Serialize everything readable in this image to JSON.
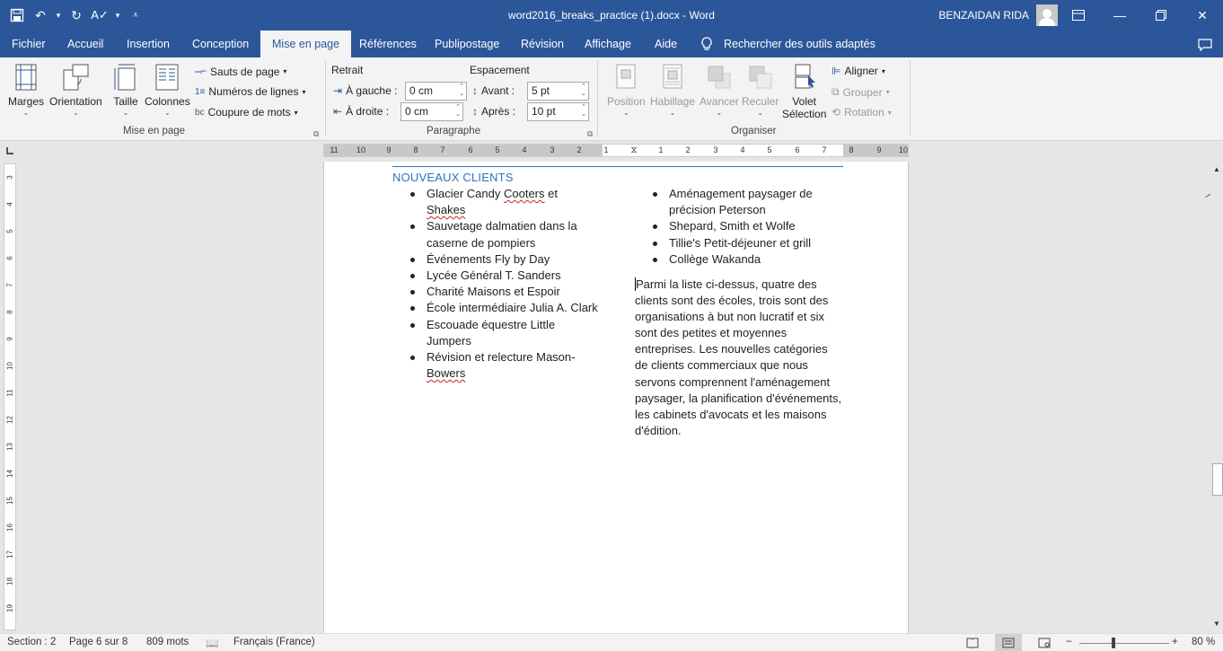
{
  "titlebar": {
    "doc_title": "word2016_breaks_practice (1).docx  -  Word",
    "user_name": "BENZAIDAN RIDA"
  },
  "tabs": [
    "Fichier",
    "Accueil",
    "Insertion",
    "Conception",
    "Mise en page",
    "Références",
    "Publipostage",
    "Révision",
    "Affichage",
    "Aide"
  ],
  "active_tab": "Mise en page",
  "tell_me": "Rechercher des outils adaptés",
  "ribbon": {
    "mise_en_page": {
      "marges": "Marges",
      "orientation": "Orientation",
      "taille": "Taille",
      "colonnes": "Colonnes",
      "sauts": "Sauts de page",
      "numeros": "Numéros de lignes",
      "coupure": "Coupure de mots",
      "label": "Mise en page"
    },
    "paragraphe": {
      "retrait": "Retrait",
      "espacement": "Espacement",
      "gauche_label": "À gauche :",
      "gauche_value": "0 cm",
      "droite_label": "À droite :",
      "droite_value": "0 cm",
      "avant_label": "Avant :",
      "avant_value": "5 pt",
      "apres_label": "Après :",
      "apres_value": "10 pt",
      "label": "Paragraphe"
    },
    "organiser": {
      "position": "Position",
      "habillage": "Habillage",
      "avancer": "Avancer",
      "reculer": "Reculer",
      "volet": "Volet",
      "selection": "Sélection",
      "aligner": "Aligner",
      "grouper": "Grouper",
      "rotation": "Rotation",
      "label": "Organiser"
    }
  },
  "ruler_labels": [
    "11",
    "10",
    "9",
    "8",
    "7",
    "6",
    "5",
    "4",
    "3",
    "2",
    "1",
    "",
    "1",
    "2",
    "3",
    "4",
    "5",
    "6",
    "7",
    "8",
    "9",
    "10"
  ],
  "vruler_labels": [
    "3",
    "4",
    "5",
    "6",
    "7",
    "8",
    "9",
    "10",
    "11",
    "12",
    "13",
    "14",
    "15",
    "16",
    "17",
    "18",
    "19"
  ],
  "document": {
    "heading": "NOUVEAUX CLIENTS",
    "left_list": [
      [
        "Glacier Candy ",
        "Cooters",
        " et ",
        "Shakes"
      ],
      [
        "Sauvetage dalmatien dans la caserne de pompiers"
      ],
      [
        "Événements Fly by Day"
      ],
      [
        "Lycée Général T. Sanders"
      ],
      [
        "Charité Maisons et Espoir"
      ],
      [
        "École intermédiaire Julia A. Clark"
      ],
      [
        "Escouade équestre Little Jumpers"
      ],
      [
        "Révision et relecture Mason-",
        "Bowers"
      ]
    ],
    "right_list": [
      "Aménagement paysager de précision Peterson",
      "Shepard, Smith et Wolfe",
      "Tillie's Petit-déjeuner et grill",
      "Collège Wakanda"
    ],
    "paragraph": "Parmi la liste ci-dessus, quatre des clients sont des écoles, trois sont des organisations à but non lucratif et six sont des petites et moyennes entreprises. Les nouvelles catégories de clients commerciaux que nous servons comprennent l'aménagement paysager, la planification d'événements, les cabinets d'avocats et les maisons d'édition."
  },
  "status": {
    "section": "Section : 2",
    "page": "Page 6 sur 8",
    "words": "809 mots",
    "language": "Français (France)",
    "zoom": "80 %"
  }
}
